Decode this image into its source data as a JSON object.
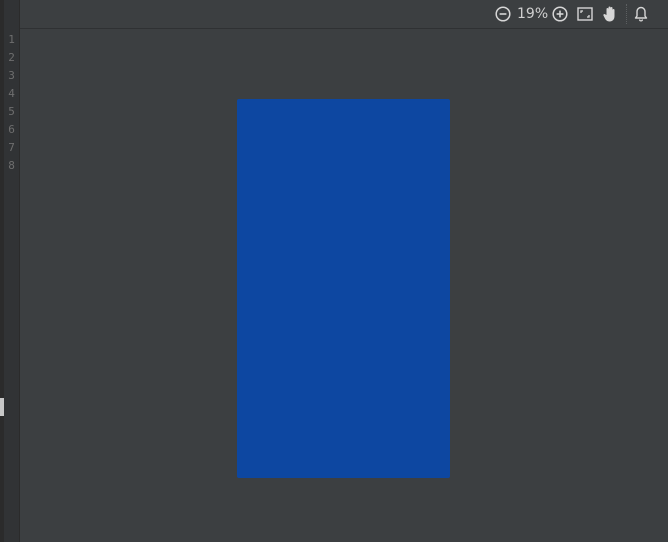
{
  "gutter": {
    "line_numbers": [
      "1",
      "2",
      "3",
      "4",
      "5",
      "6",
      "7",
      "8"
    ]
  },
  "toolbar": {
    "zoom_out_icon": "minus-circle-icon",
    "zoom_level": "19%",
    "zoom_in_icon": "plus-circle-icon",
    "actual_size_icon": "actual-size-icon",
    "pan_icon": "hand-icon",
    "notifications_icon": "bell-icon"
  },
  "preview": {
    "color": "#0d47a1"
  },
  "colors": {
    "background": "#3c3f41",
    "gutter": "#313335",
    "icon": "#d6d6d6"
  }
}
